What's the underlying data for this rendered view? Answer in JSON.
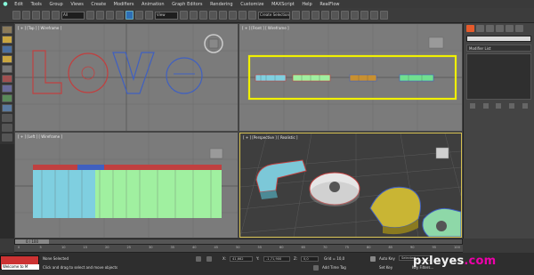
{
  "menu": {
    "items": [
      "Edit",
      "Tools",
      "Group",
      "Views",
      "Create",
      "Modifiers",
      "Animation",
      "Graph Editors",
      "Rendering",
      "Customize",
      "MAXScript",
      "Help",
      "RealFlow"
    ]
  },
  "toolbar": {
    "selection_filter": "All",
    "ref_coord": "View",
    "named_sel": "Create Selection Set"
  },
  "viewports": {
    "top": {
      "label": "[ + ] [Top ] [ Wireframe ]"
    },
    "front": {
      "label": "[ + ] [Front ] [ Wireframe ]"
    },
    "left": {
      "label": "[ + ] [Left ] [ Wireframe ]"
    },
    "perspective": {
      "label": "[ + ] [Perspective ] [ Realistic ]"
    }
  },
  "command_panel": {
    "modifier_list": "Modifier List"
  },
  "timeline": {
    "frame_display": "0 / 100",
    "ticks": [
      "0",
      "5",
      "10",
      "15",
      "20",
      "25",
      "30",
      "35",
      "40",
      "45",
      "50",
      "55",
      "60",
      "65",
      "70",
      "75",
      "80",
      "85",
      "90",
      "95",
      "100"
    ]
  },
  "status": {
    "script_label": "Welcome to M",
    "selection_info": "None Selected",
    "prompt": "Click and drag to select and move objects",
    "x_value": "41,662",
    "y_value": "-1,71,900",
    "z_value": "0,0",
    "grid": "Grid = 10,0",
    "add_time_tag": "Add Time Tag",
    "auto_key": "Auto Key",
    "set_key": "Set Key",
    "key_mode": "Selected",
    "key_filters": "Key Filters..."
  },
  "watermark": {
    "brand": "pxleyes",
    "suffix": ".com"
  },
  "colors": {
    "accent": "#e55a2b",
    "active_viewport": "#d5c050",
    "selection_highlight": "#f0f000",
    "script_listener": "#cc3333"
  }
}
